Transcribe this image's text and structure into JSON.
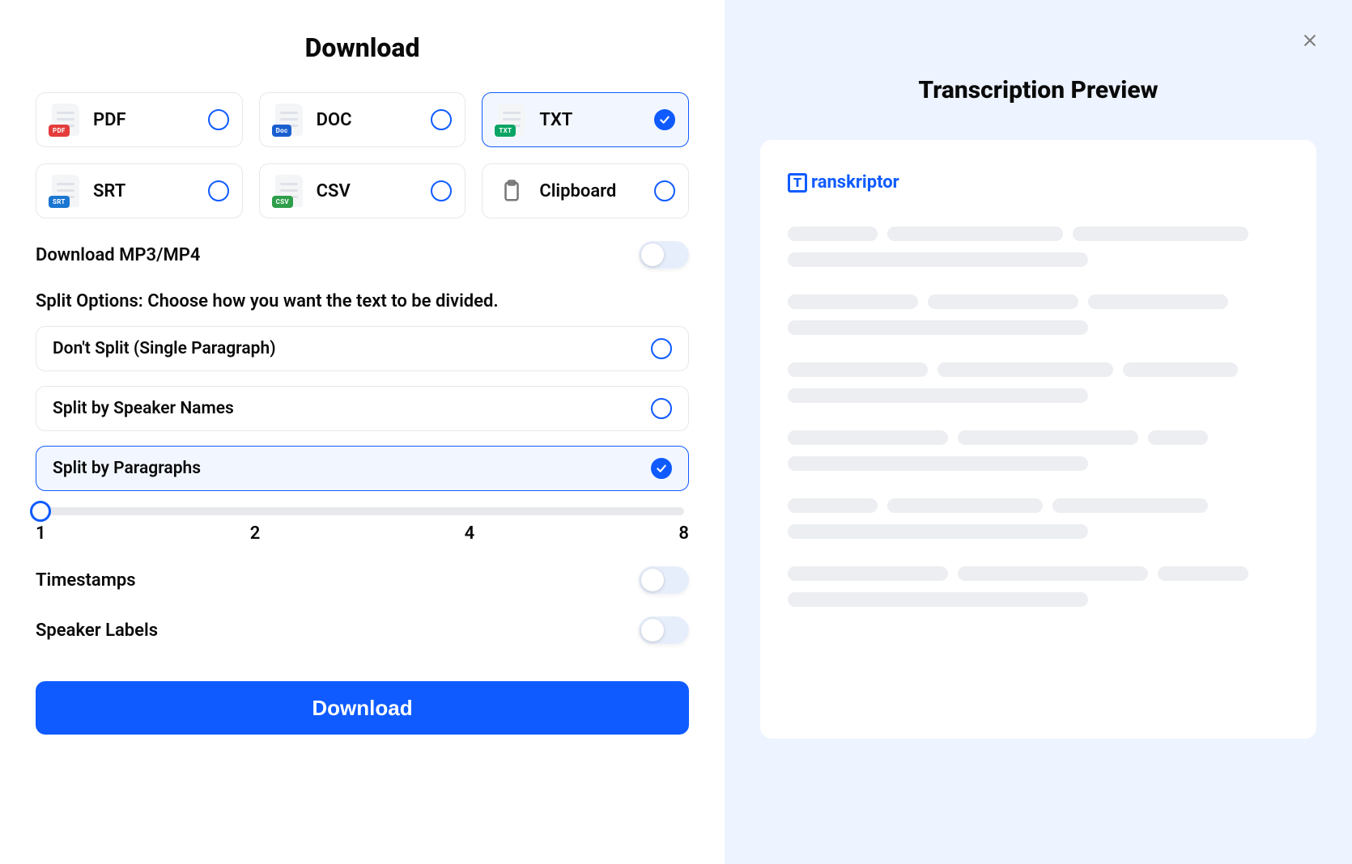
{
  "left": {
    "title": "Download",
    "formats": [
      {
        "id": "pdf",
        "label": "PDF",
        "badge": "PDF",
        "badgeClass": "pdf",
        "selected": false
      },
      {
        "id": "doc",
        "label": "DOC",
        "badge": "Doc",
        "badgeClass": "doc",
        "selected": false
      },
      {
        "id": "txt",
        "label": "TXT",
        "badge": "TXT",
        "badgeClass": "txt",
        "selected": true
      },
      {
        "id": "srt",
        "label": "SRT",
        "badge": "SRT",
        "badgeClass": "srt",
        "selected": false
      },
      {
        "id": "csv",
        "label": "CSV",
        "badge": "CSV",
        "badgeClass": "csv",
        "selected": false
      },
      {
        "id": "clipboard",
        "label": "Clipboard",
        "badge": "",
        "badgeClass": "",
        "selected": false
      }
    ],
    "downloadMedia": {
      "label": "Download MP3/MP4",
      "on": false
    },
    "splitHeading": "Split Options: Choose how you want the text to be divided.",
    "splitOptions": [
      {
        "label": "Don't Split (Single Paragraph)",
        "selected": false
      },
      {
        "label": "Split by Speaker Names",
        "selected": false
      },
      {
        "label": "Split by Paragraphs",
        "selected": true
      }
    ],
    "slider": {
      "value": 1,
      "marks": [
        "1",
        "2",
        "4",
        "8"
      ]
    },
    "timestamps": {
      "label": "Timestamps",
      "on": false
    },
    "speakerLabels": {
      "label": "Speaker Labels",
      "on": false
    },
    "downloadButton": "Download"
  },
  "right": {
    "title": "Transcription Preview",
    "brand": "ranskriptor",
    "brandLetter": "T",
    "skeleton": [
      [
        18,
        35,
        35
      ],
      [
        26,
        30,
        28
      ],
      [
        28,
        35,
        23
      ],
      [
        32,
        36,
        12
      ],
      [
        18,
        31,
        31
      ],
      [
        32,
        38,
        18
      ]
    ]
  }
}
